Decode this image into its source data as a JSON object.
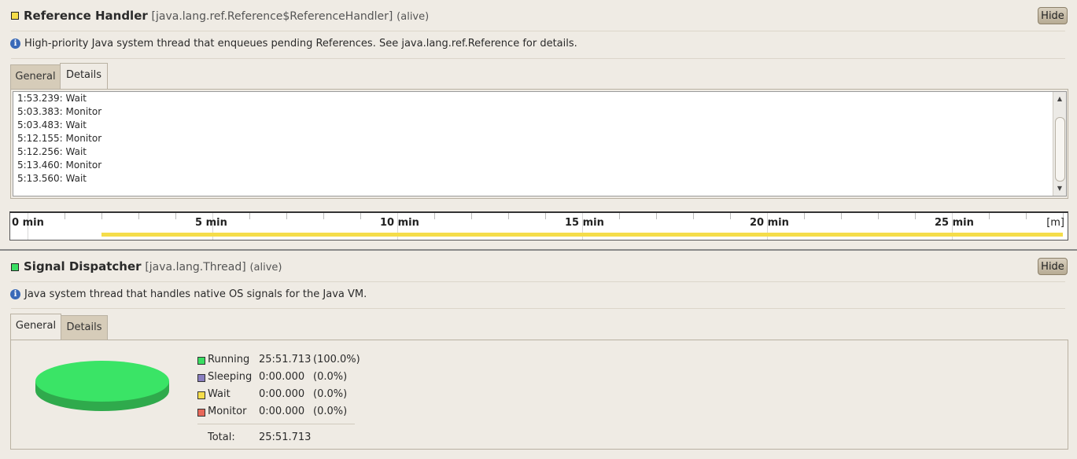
{
  "colors": {
    "running": "#3ade62",
    "sleeping": "#8a7fc0",
    "wait": "#f5dd4a",
    "monitor": "#e8685a",
    "pie_top": "#3ae466",
    "pie_side": "#2faa4c"
  },
  "panel1": {
    "status_color": "#f5dd4a",
    "thread_name": "Reference Handler",
    "thread_class": "[java.lang.ref.Reference$ReferenceHandler]",
    "thread_state": "(alive)",
    "hide_label": "Hide",
    "info_icon": "info-icon",
    "description": "High-priority Java system thread that enqueues pending References. See java.lang.ref.Reference for details.",
    "tabs": [
      {
        "label": "General",
        "active": false
      },
      {
        "label": "Details",
        "active": true
      }
    ],
    "log": [
      "1:53.239: Wait",
      "5:03.383: Monitor",
      "5:03.483: Wait",
      "5:12.155: Monitor",
      "5:12.256: Wait",
      "5:13.460: Monitor",
      "5:13.560: Wait"
    ],
    "timeline": {
      "labels": [
        "0 min",
        "5 min",
        "10 min",
        "15 min",
        "20 min",
        "25 min"
      ],
      "unit": "[m]",
      "wait_bar_from_min": 2.0,
      "wait_bar_to_min": 28.0
    }
  },
  "panel2": {
    "status_color": "#3ade62",
    "thread_name": "Signal Dispatcher",
    "thread_class": "[java.lang.Thread]",
    "thread_state": "(alive)",
    "hide_label": "Hide",
    "info_icon": "info-icon",
    "description": "Java system thread that handles native OS signals for the Java VM.",
    "tabs": [
      {
        "label": "General",
        "active": true
      },
      {
        "label": "Details",
        "active": false
      }
    ],
    "legend": [
      {
        "label": "Running",
        "time": "25:51.713",
        "pct": "(100.0%)",
        "color": "#3ade62"
      },
      {
        "label": "Sleeping",
        "time": "0:00.000",
        "pct": "(0.0%)",
        "color": "#8a7fc0"
      },
      {
        "label": "Wait",
        "time": "0:00.000",
        "pct": "(0.0%)",
        "color": "#f5dd4a"
      },
      {
        "label": "Monitor",
        "time": "0:00.000",
        "pct": "(0.0%)",
        "color": "#e8685a"
      }
    ],
    "total_label": "Total:",
    "total_time": "25:51.713",
    "pie_running_fraction": 1.0
  }
}
